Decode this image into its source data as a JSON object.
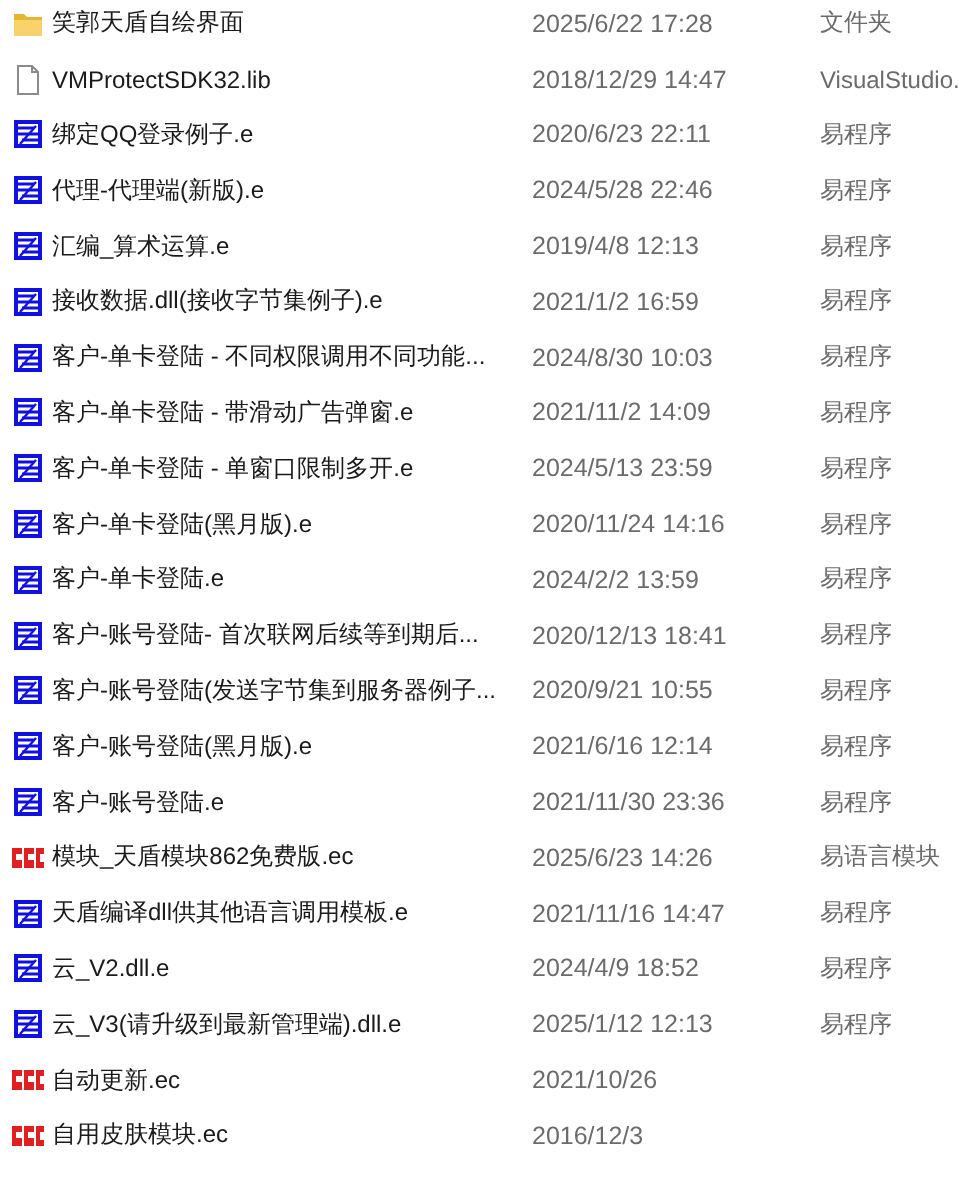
{
  "files": [
    {
      "kind": "folder",
      "name": "笑郭天盾自绘界面",
      "modified": "2025/6/22 17:28",
      "type": "文件夹"
    },
    {
      "kind": "file",
      "name": "VMProtectSDK32.lib",
      "modified": "2018/12/29 14:47",
      "type": "VisualStudio."
    },
    {
      "kind": "program",
      "name": "绑定QQ登录例子.e",
      "modified": "2020/6/23 22:11",
      "type": "易程序"
    },
    {
      "kind": "program",
      "name": "代理-代理端(新版).e",
      "modified": "2024/5/28 22:46",
      "type": "易程序"
    },
    {
      "kind": "program",
      "name": "汇编_算术运算.e",
      "modified": "2019/4/8 12:13",
      "type": "易程序"
    },
    {
      "kind": "program",
      "name": "接收数据.dll(接收字节集例子).e",
      "modified": "2021/1/2 16:59",
      "type": "易程序"
    },
    {
      "kind": "program",
      "name": "客户-单卡登陆 - 不同权限调用不同功能...",
      "modified": "2024/8/30 10:03",
      "type": "易程序"
    },
    {
      "kind": "program",
      "name": "客户-单卡登陆 - 带滑动广告弹窗.e",
      "modified": "2021/11/2 14:09",
      "type": "易程序"
    },
    {
      "kind": "program",
      "name": "客户-单卡登陆 - 单窗口限制多开.e",
      "modified": "2024/5/13 23:59",
      "type": "易程序"
    },
    {
      "kind": "program",
      "name": "客户-单卡登陆(黑月版).e",
      "modified": "2020/11/24 14:16",
      "type": "易程序"
    },
    {
      "kind": "program",
      "name": "客户-单卡登陆.e",
      "modified": "2024/2/2 13:59",
      "type": "易程序"
    },
    {
      "kind": "program",
      "name": "客户-账号登陆- 首次联网后续等到期后...",
      "modified": "2020/12/13 18:41",
      "type": "易程序"
    },
    {
      "kind": "program",
      "name": "客户-账号登陆(发送字节集到服务器例子...",
      "modified": "2020/9/21 10:55",
      "type": "易程序"
    },
    {
      "kind": "program",
      "name": "客户-账号登陆(黑月版).e",
      "modified": "2021/6/16 12:14",
      "type": "易程序"
    },
    {
      "kind": "program",
      "name": "客户-账号登陆.e",
      "modified": "2021/11/30 23:36",
      "type": "易程序"
    },
    {
      "kind": "module",
      "name": "模块_天盾模块862免费版.ec",
      "modified": "2025/6/23 14:26",
      "type": "易语言模块"
    },
    {
      "kind": "program",
      "name": "天盾编译dll供其他语言调用模板.e",
      "modified": "2021/11/16 14:47",
      "type": "易程序"
    },
    {
      "kind": "program",
      "name": "云_V2.dll.e",
      "modified": "2024/4/9 18:52",
      "type": "易程序"
    },
    {
      "kind": "program",
      "name": "云_V3(请升级到最新管理端).dll.e",
      "modified": "2025/1/12 12:13",
      "type": "易程序"
    },
    {
      "kind": "module",
      "name": "自动更新.ec",
      "modified": "2021/10/26"
    },
    {
      "kind": "module",
      "name": "自用皮肤模块.ec",
      "modified": "2016/12/3"
    }
  ]
}
